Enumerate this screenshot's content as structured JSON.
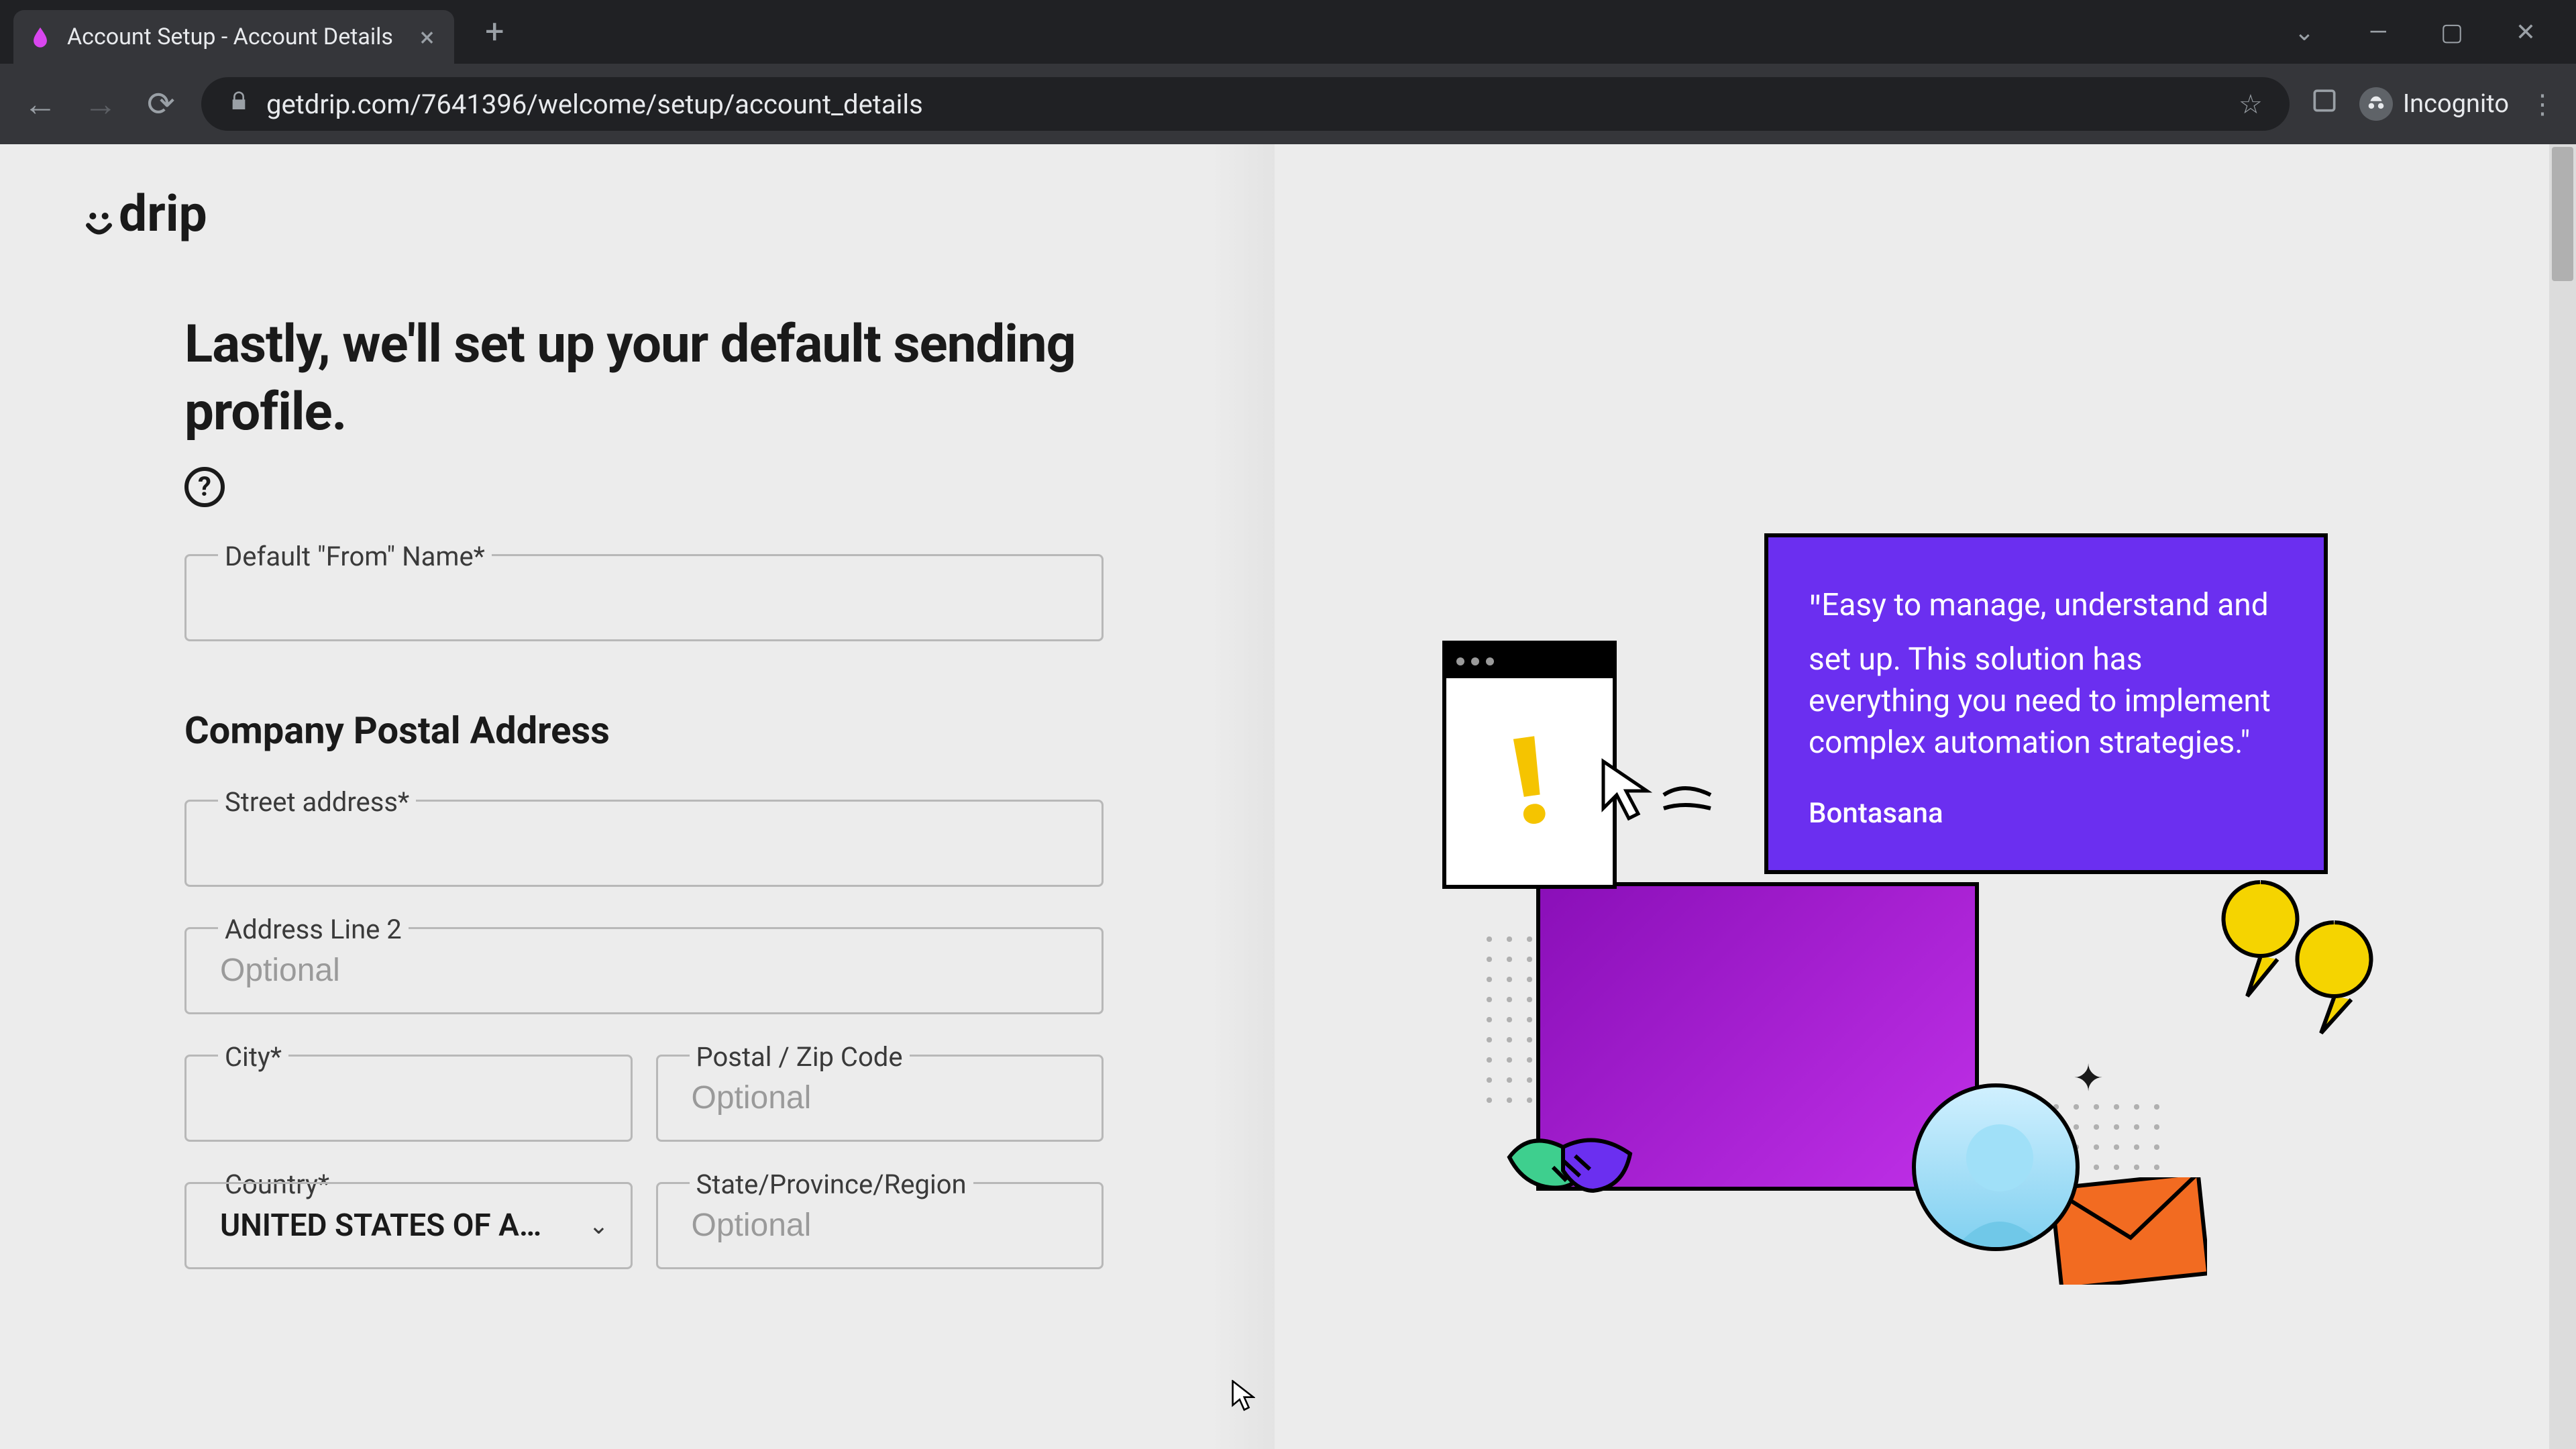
{
  "browser": {
    "tab_title": "Account Setup - Account Details",
    "url": "getdrip.com/7641396/welcome/setup/account_details",
    "incognito_label": "Incognito"
  },
  "logo_text": "drip",
  "heading": "Lastly, we'll set up your default sending profile.",
  "form": {
    "from_name": {
      "label": "Default \"From\" Name*",
      "value": ""
    },
    "postal_section": "Company Postal Address",
    "street": {
      "label": "Street address*",
      "value": ""
    },
    "line2": {
      "label": "Address Line 2",
      "placeholder": "Optional",
      "value": ""
    },
    "city": {
      "label": "City*",
      "value": ""
    },
    "postal": {
      "label": "Postal / Zip Code",
      "placeholder": "Optional",
      "value": ""
    },
    "country": {
      "label": "Country*",
      "selected": "UNITED STATES OF A…"
    },
    "state": {
      "label": "State/Province/Region",
      "placeholder": "Optional",
      "value": ""
    }
  },
  "quote": {
    "text": "Easy to manage, understand and set up. This solution has everything you need to implement complex automation strategies.\"",
    "author": "Bontasana"
  }
}
